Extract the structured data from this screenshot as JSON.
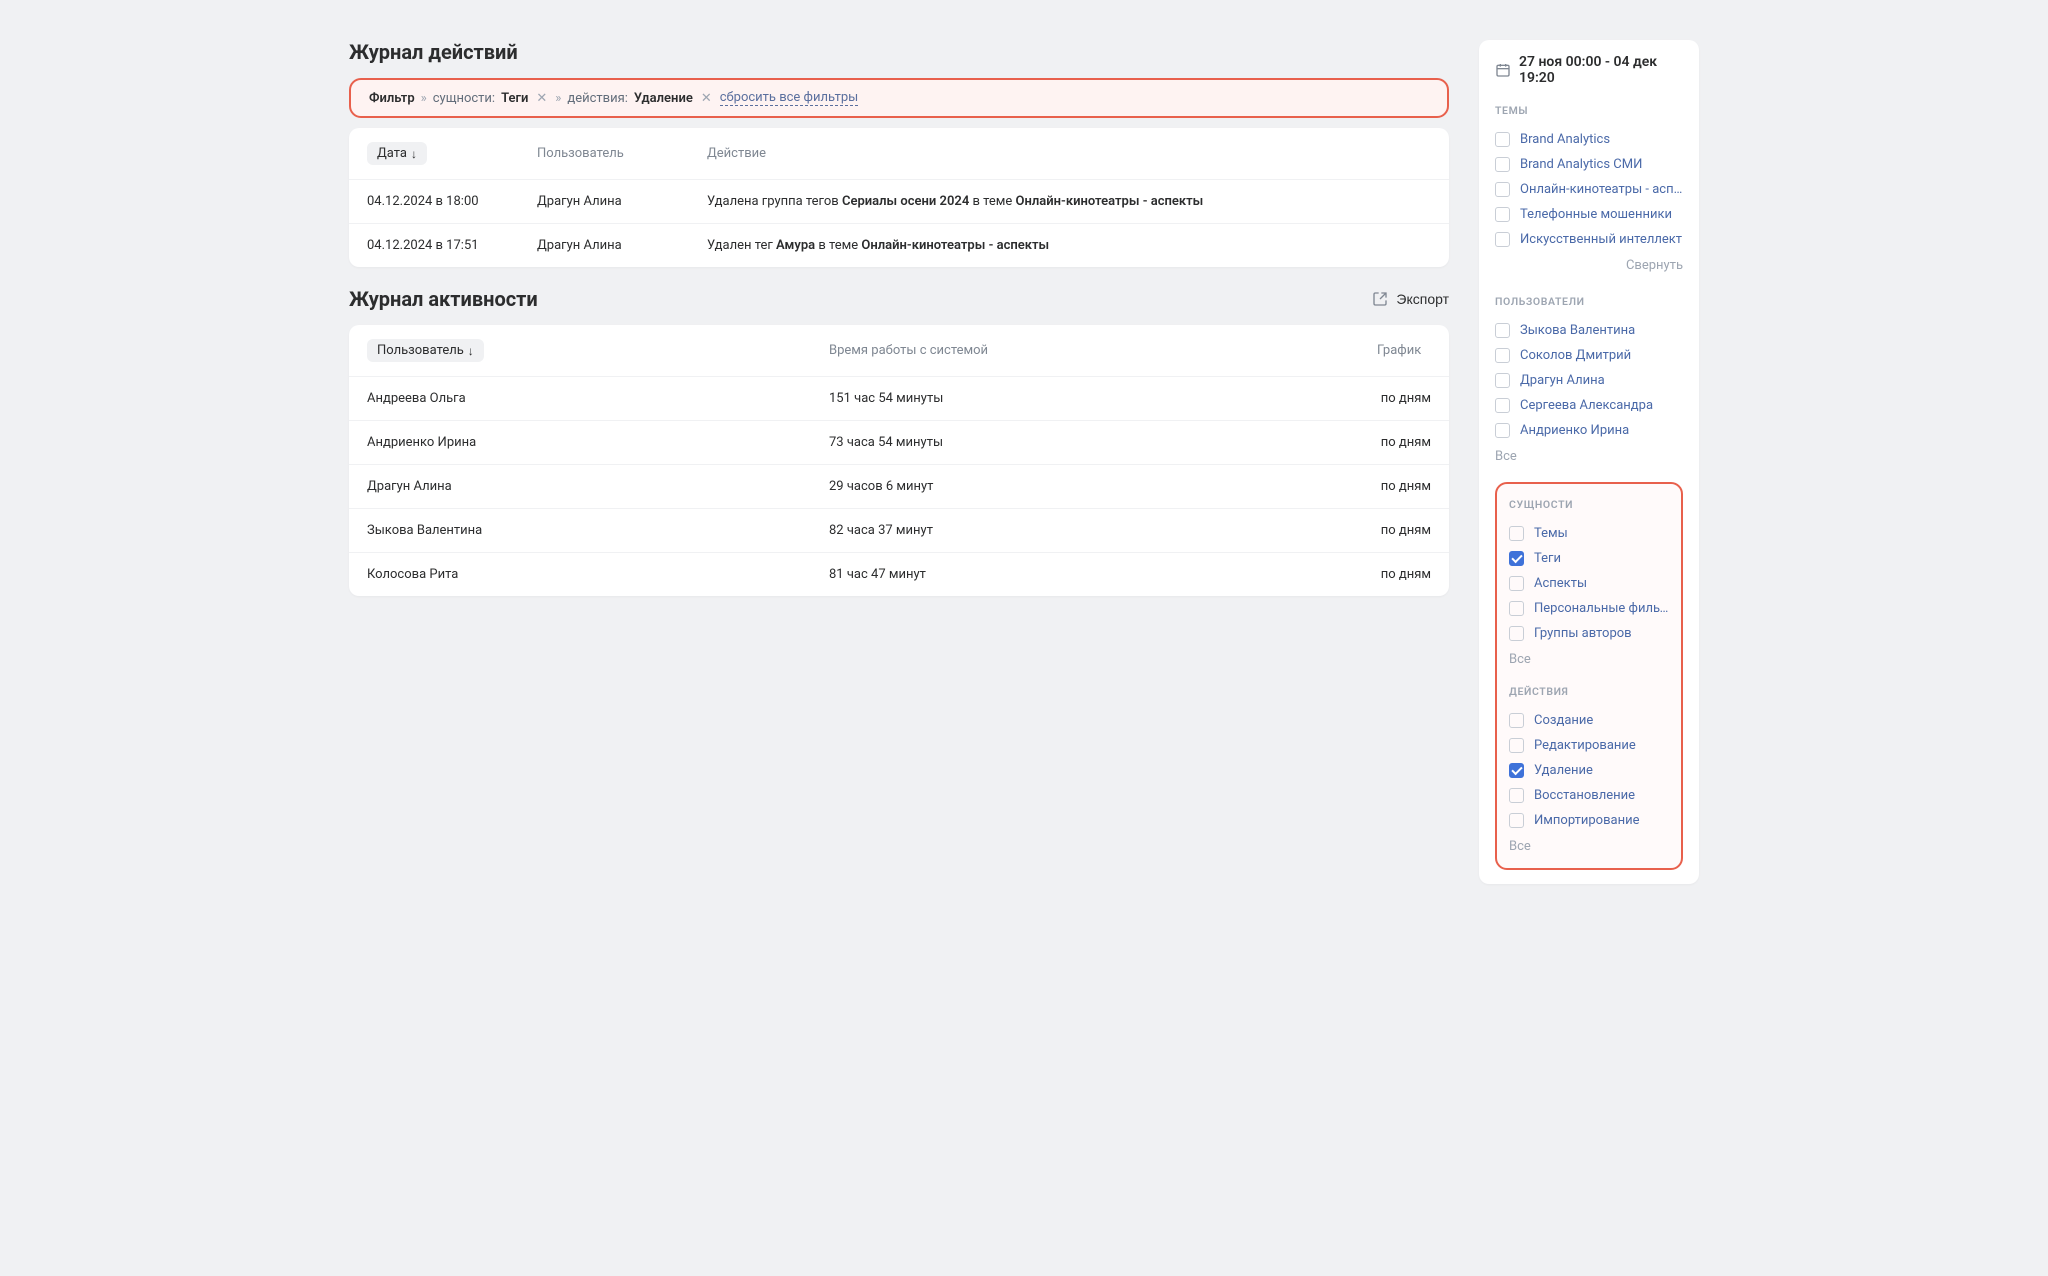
{
  "sections": {
    "actions_title": "Журнал действий",
    "activity_title": "Журнал активности",
    "export": "Экспорт"
  },
  "filter_bar": {
    "label": "Фильтр",
    "chev": "»",
    "entities_prefix": "сущности:",
    "entities_value": "Теги",
    "actions_prefix": "действия:",
    "actions_value": "Удаление",
    "reset": "сбросить все фильтры"
  },
  "actions_table": {
    "headers": {
      "date": "Дата",
      "user": "Пользователь",
      "action": "Действие"
    },
    "sort_indicator": "↓",
    "rows": [
      {
        "date": "04.12.2024 в 18:00",
        "user": "Драгун Алина",
        "action_parts": [
          "Удалена группа тегов ",
          "Сериалы осени 2024",
          " в теме ",
          "Онлайн-кинотеатры - аспекты"
        ]
      },
      {
        "date": "04.12.2024 в 17:51",
        "user": "Драгун Алина",
        "action_parts": [
          "Удален тег ",
          "Амура",
          " в теме ",
          "Онлайн-кинотеатры - аспекты"
        ]
      }
    ]
  },
  "activity_table": {
    "headers": {
      "user": "Пользователь",
      "time": "Время работы с системой",
      "chart": "График"
    },
    "sort_indicator": "↓",
    "link_label": "по дням",
    "rows": [
      {
        "user": "Андреева Ольга",
        "time": "151 час 54 минуты"
      },
      {
        "user": "Андриенко Ирина",
        "time": "73 часа 54 минуты"
      },
      {
        "user": "Драгун Алина",
        "time": "29 часов 6 минут"
      },
      {
        "user": "Зыкова Валентина",
        "time": "82 часа 37 минут"
      },
      {
        "user": "Колосова Рита",
        "time": "81 час 47 минут"
      }
    ]
  },
  "sidebar": {
    "date_range": "27 ноя 00:00 - 04 дек 19:20",
    "all_label": "Все",
    "collapse_label": "Свернуть",
    "themes": {
      "title": "ТЕМЫ",
      "items": [
        {
          "label": "Brand Analytics",
          "checked": false
        },
        {
          "label": "Brand Analytics СМИ",
          "checked": false
        },
        {
          "label": "Онлайн-кинотеатры - аспе...",
          "checked": false
        },
        {
          "label": "Телефонные мошенники",
          "checked": false
        },
        {
          "label": "Искусственный интеллект",
          "checked": false
        }
      ]
    },
    "users": {
      "title": "ПОЛЬЗОВАТЕЛИ",
      "items": [
        {
          "label": "Зыкова Валентина",
          "checked": false
        },
        {
          "label": "Соколов Дмитрий",
          "checked": false
        },
        {
          "label": "Драгун Алина",
          "checked": false
        },
        {
          "label": "Сергеева Александра",
          "checked": false
        },
        {
          "label": "Андриенко Ирина",
          "checked": false
        }
      ]
    },
    "entities": {
      "title": "СУЩНОСТИ",
      "items": [
        {
          "label": "Темы",
          "checked": false
        },
        {
          "label": "Теги",
          "checked": true
        },
        {
          "label": "Аспекты",
          "checked": false
        },
        {
          "label": "Персональные фильтры",
          "checked": false
        },
        {
          "label": "Группы авторов",
          "checked": false
        }
      ]
    },
    "actions": {
      "title": "ДЕЙСТВИЯ",
      "items": [
        {
          "label": "Создание",
          "checked": false
        },
        {
          "label": "Редактирование",
          "checked": false
        },
        {
          "label": "Удаление",
          "checked": true
        },
        {
          "label": "Восстановление",
          "checked": false
        },
        {
          "label": "Импортирование",
          "checked": false
        }
      ]
    }
  }
}
